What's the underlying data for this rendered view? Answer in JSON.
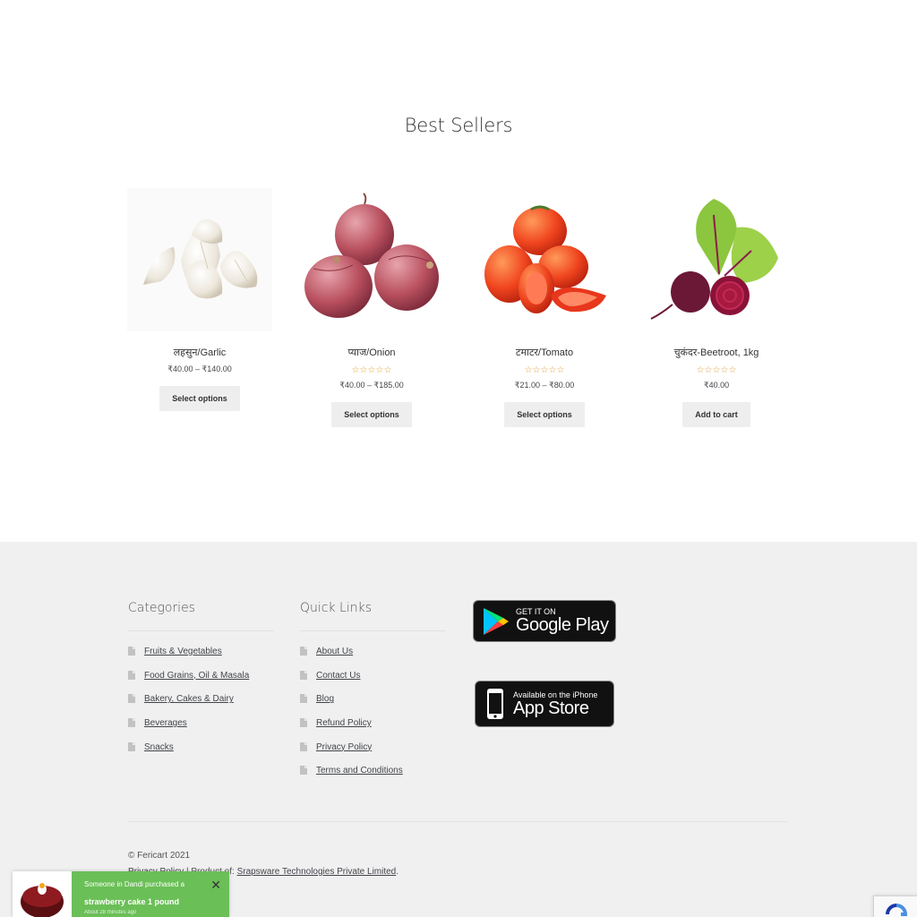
{
  "section": {
    "title": "Best Sellers"
  },
  "products": [
    {
      "name": "लहसुन/Garlic",
      "rating": "",
      "price": "₹40.00 – ₹140.00",
      "button": "Select options"
    },
    {
      "name": "प्याज/Onion",
      "rating": "☆☆☆☆☆",
      "price": "₹40.00 – ₹185.00",
      "button": "Select options"
    },
    {
      "name": "टमाटर/Tomato",
      "rating": "☆☆☆☆☆",
      "price": "₹21.00 – ₹80.00",
      "button": "Select options"
    },
    {
      "name": "चुकंदर-Beetroot, 1kg",
      "rating": "☆☆☆☆☆",
      "price": "₹40.00",
      "button": "Add to cart"
    }
  ],
  "footer": {
    "categories": {
      "title": "Categories",
      "items": [
        "Fruits & Vegetables",
        "Food Grains, Oil & Masala",
        "Bakery, Cakes & Dairy",
        "Beverages",
        "Snacks"
      ]
    },
    "quick_links": {
      "title": "Quick Links",
      "items": [
        "About Us",
        "Contact Us",
        "Blog",
        "Refund Policy",
        "Privacy Policy",
        "Terms and Conditions"
      ]
    },
    "google_play": {
      "small": "GET IT ON",
      "big": "Google Play"
    },
    "app_store": {
      "small": "Available on the iPhone",
      "big": "App Store"
    },
    "copyright": "© Fericart 2021",
    "legal": {
      "privacy": "Privacy Policy",
      "separator": "|",
      "product_of": "Product of:",
      "company": "Srapsware Technologies Private Limited",
      "end": "."
    }
  },
  "toast": {
    "line1": "Someone in Dandi purchased a",
    "line2": "strawberry cake 1 pound",
    "line3": "About 28 minutes ago",
    "close": "✕"
  },
  "colors": {
    "footer_bg": "#f0f0f0",
    "toast_bg": "#6bbf57",
    "star": "#e3a33a",
    "button_bg": "#eeeeee"
  }
}
